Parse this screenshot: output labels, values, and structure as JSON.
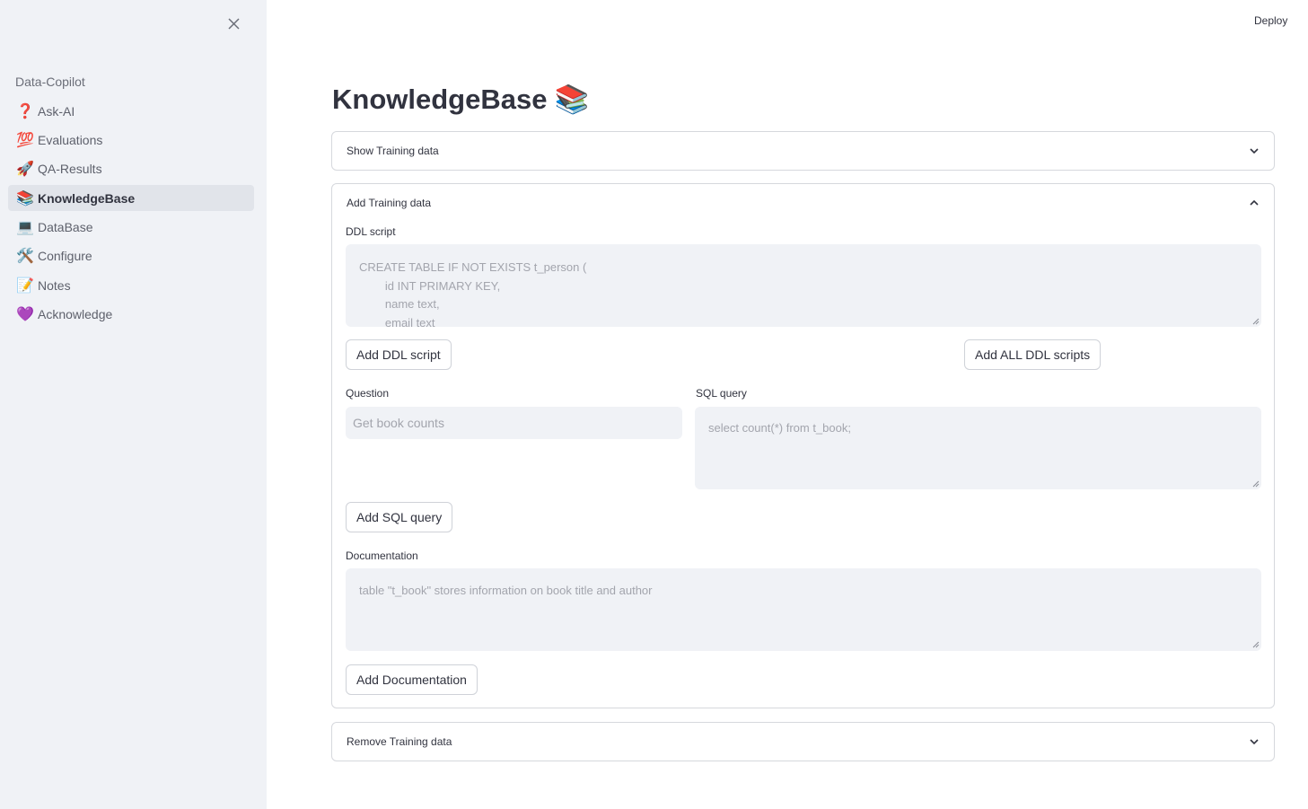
{
  "sidebar": {
    "heading": "Data-Copilot",
    "items": [
      {
        "icon": "❓",
        "label": "Ask-AI"
      },
      {
        "icon": "💯",
        "label": "Evaluations"
      },
      {
        "icon": "🚀",
        "label": "QA-Results"
      },
      {
        "icon": "📚",
        "label": "KnowledgeBase",
        "active": true
      },
      {
        "icon": "💻",
        "label": "DataBase"
      },
      {
        "icon": "🛠️",
        "label": "Configure"
      },
      {
        "icon": "📝",
        "label": "Notes"
      },
      {
        "icon": "💜",
        "label": "Acknowledge"
      }
    ]
  },
  "header": {
    "deploy_label": "Deploy"
  },
  "page": {
    "title": "KnowledgeBase",
    "title_icon": "📚"
  },
  "show_training": {
    "label": "Show Training data"
  },
  "add_training": {
    "label": "Add Training data",
    "ddl_label": "DDL script",
    "ddl_placeholder": "CREATE TABLE IF NOT EXISTS t_person (\n        id INT PRIMARY KEY,\n        name text,\n        email text",
    "add_ddl_button": "Add DDL script",
    "add_all_ddl_button": "Add ALL DDL scripts",
    "question_label": "Question",
    "question_placeholder": "Get book counts",
    "sql_label": "SQL query",
    "sql_placeholder": "select count(*) from t_book;",
    "add_sql_button": "Add SQL query",
    "doc_label": "Documentation",
    "doc_placeholder": "table \"t_book\" stores information on book title and author",
    "add_doc_button": "Add Documentation"
  },
  "remove_training": {
    "label": "Remove Training data"
  }
}
